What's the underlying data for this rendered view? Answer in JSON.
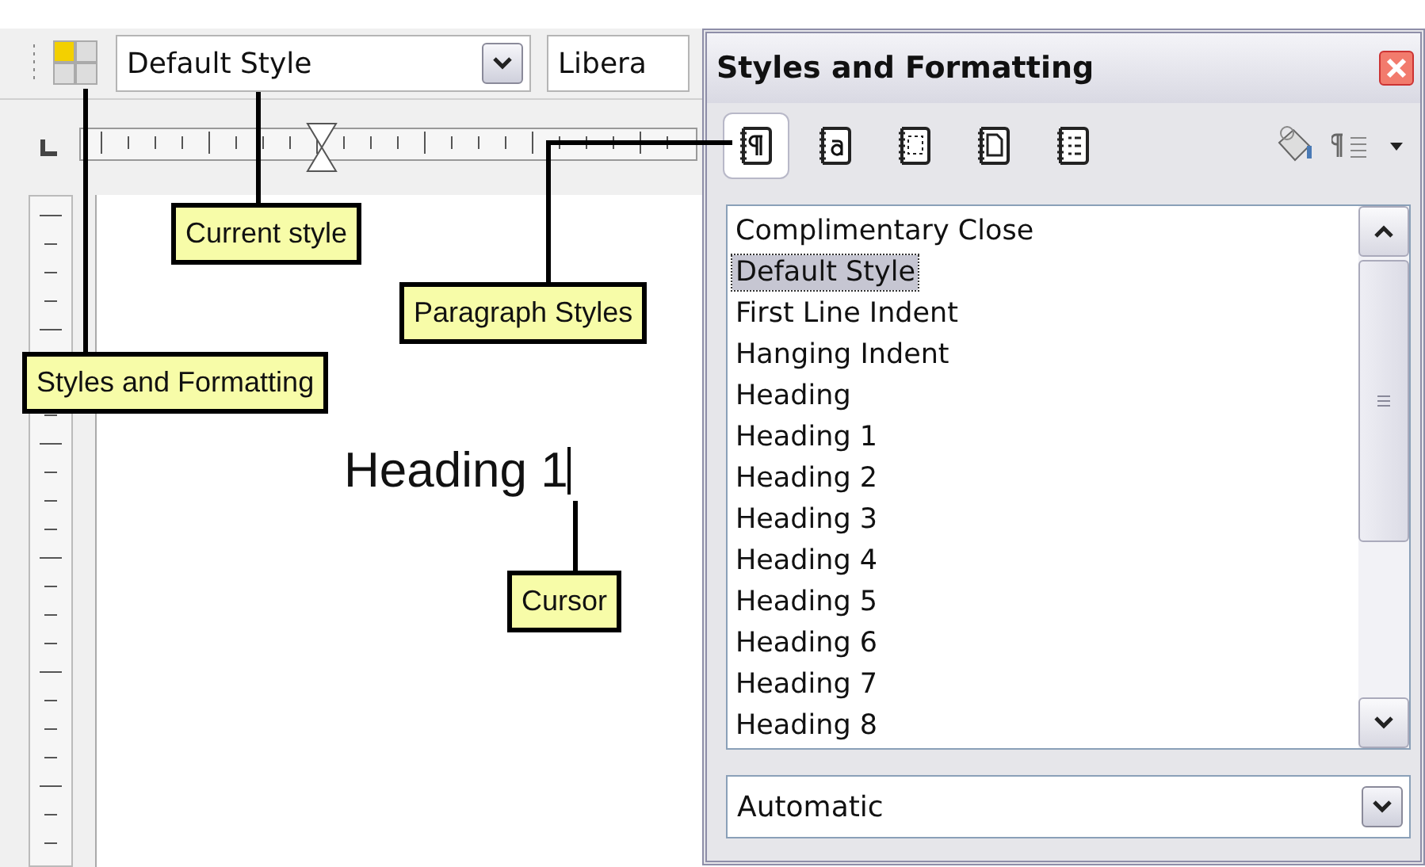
{
  "toolbar": {
    "style_box": {
      "value": "Default Style"
    },
    "font_box": {
      "value": "Libera"
    }
  },
  "document": {
    "text": "Heading 1"
  },
  "panel": {
    "title": "Styles and Formatting",
    "categories": [
      {
        "kind": "paragraph",
        "selected": true
      },
      {
        "kind": "character",
        "selected": false
      },
      {
        "kind": "frame",
        "selected": false
      },
      {
        "kind": "page",
        "selected": false
      },
      {
        "kind": "list",
        "selected": false
      }
    ],
    "styles": [
      {
        "label": "Complimentary Close",
        "selected": false
      },
      {
        "label": "Default Style",
        "selected": true
      },
      {
        "label": "First Line Indent",
        "selected": false
      },
      {
        "label": "Hanging Indent",
        "selected": false
      },
      {
        "label": "Heading",
        "selected": false
      },
      {
        "label": "Heading 1",
        "selected": false
      },
      {
        "label": "Heading 2",
        "selected": false
      },
      {
        "label": "Heading 3",
        "selected": false
      },
      {
        "label": "Heading 4",
        "selected": false
      },
      {
        "label": "Heading 5",
        "selected": false
      },
      {
        "label": "Heading 6",
        "selected": false
      },
      {
        "label": "Heading 7",
        "selected": false
      },
      {
        "label": "Heading 8",
        "selected": false
      }
    ],
    "filter": {
      "value": "Automatic"
    }
  },
  "callouts": [
    {
      "label": "Current style"
    },
    {
      "label": "Paragraph Styles"
    },
    {
      "label": "Styles and Formatting"
    },
    {
      "label": "Cursor"
    }
  ]
}
